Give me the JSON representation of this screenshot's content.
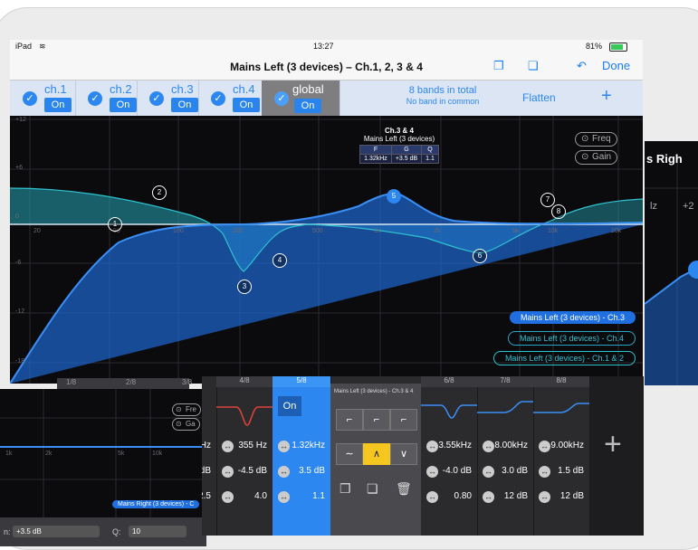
{
  "statusbar": {
    "device": "iPad",
    "wifi_icon": "wifi-icon",
    "time": "13:27",
    "battery": "81%"
  },
  "navbar": {
    "title": "Mains Left (3 devices) – Ch.1, 2, 3 & 4",
    "done": "Done"
  },
  "channels": [
    {
      "label": "ch.1",
      "state": "On"
    },
    {
      "label": "ch.2",
      "state": "On"
    },
    {
      "label": "ch.3",
      "state": "On"
    },
    {
      "label": "ch.4",
      "state": "On"
    },
    {
      "label": "global",
      "state": "On"
    }
  ],
  "bands": {
    "total": "8 bands in total",
    "common": "No band in common",
    "flatten": "Flatten",
    "add": "+"
  },
  "graph": {
    "y_ticks": [
      "+12",
      "+6",
      "0",
      "-6",
      "-12",
      "-18"
    ],
    "x_ticks": [
      "20",
      "50",
      "100",
      "200",
      "500",
      "1k",
      "2k",
      "5k",
      "10k",
      "20k"
    ],
    "freq_toggle": "Freq",
    "gain_toggle": "Gain",
    "popup": {
      "title": "Ch.3 & 4",
      "subtitle": "Mains Left (3 devices)",
      "headers": [
        "F",
        "G",
        "Q"
      ],
      "values": [
        "1.32kHz",
        "+3.5 dB",
        "1.1"
      ]
    },
    "band_nodes": [
      "1",
      "2",
      "3",
      "4",
      "5",
      "6",
      "7",
      "8"
    ],
    "legend": [
      "Mains Left (3 devices) - Ch.3",
      "Mains Left (3 devices) - Ch.4",
      "Mains Left (3 devices) - Ch.1 & 2"
    ],
    "colors": {
      "ch3": "#1f6fe0",
      "ch4": "#2aa6c8",
      "ch12": "#2fc2d0"
    }
  },
  "right_panel": {
    "title": "s Righ",
    "hz": "lz",
    "gain": "+2"
  },
  "left_panel": {
    "freq_pill": "Fre",
    "gain_pill": "Ga",
    "x_ticks": [
      "1k",
      "2k",
      "5k",
      "10k"
    ],
    "legend": "Mains Right (3 devices) - C",
    "bottom_gain_label": "n:",
    "bottom_gain_value": "+3.5 dB",
    "bottom_q_label": "Q:",
    "bottom_q_value": "10"
  },
  "strip": {
    "band_headers": [
      "1/8",
      "2/8",
      "3/8",
      "4/8",
      "5/8",
      "6/8",
      "7/8",
      "8/8"
    ],
    "active_state": "On",
    "menu_title": "Mains Left (3 devices) - Ch.3 & 4",
    "freq_row": [
      "Hz",
      "355 Hz",
      "1.32kHz",
      "3.55kHz",
      "8.00kHz",
      "9.00kHz"
    ],
    "gain_row": [
      "dB",
      "-4.5 dB",
      "3.5 dB",
      "-4.0 dB",
      "3.0 dB",
      "1.5 dB"
    ],
    "q_row": [
      "2.5",
      "4.0",
      "1.1",
      "0.80",
      "12 dB",
      "12 dB"
    ]
  }
}
